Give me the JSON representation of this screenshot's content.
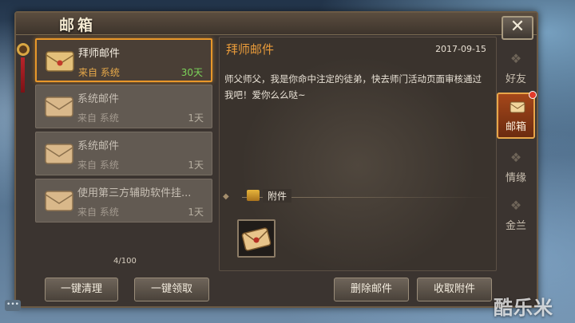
{
  "window": {
    "title": "邮箱",
    "close_glyph": "✕"
  },
  "mails": [
    {
      "subject": "拜师邮件",
      "from": "来自 系统",
      "days": "30天",
      "selected": true
    },
    {
      "subject": "系统邮件",
      "from": "来自 系统",
      "days": "1天",
      "selected": false
    },
    {
      "subject": "系统邮件",
      "from": "来自 系统",
      "days": "1天",
      "selected": false
    },
    {
      "subject": "使用第三方辅助软件挂...",
      "from": "来自 系统",
      "days": "1天",
      "selected": false
    }
  ],
  "mail_count": "4/100",
  "detail": {
    "title": "拜师邮件",
    "date": "2017-09-15",
    "body": "师父师父，我是你命中注定的徒弟，快去师门活动页面审核通过我吧！爱你么么哒~",
    "attachment_label": "附件"
  },
  "buttons": {
    "clear_all": "一键清理",
    "collect_all": "一键领取",
    "delete": "删除邮件",
    "collect_attachment": "收取附件"
  },
  "tabs": [
    {
      "label": "好友",
      "icon": "paw-icon",
      "active": false
    },
    {
      "label": "邮箱",
      "icon": "envelope-icon",
      "active": true
    },
    {
      "label": "情缘",
      "icon": "paw-icon",
      "active": false
    },
    {
      "label": "金兰",
      "icon": "paw-icon",
      "active": false
    }
  ],
  "colors": {
    "accent": "#e8972a",
    "active_tab": "#a5471a",
    "days_highlight": "#7bd35a"
  },
  "watermark": "酷乐米"
}
